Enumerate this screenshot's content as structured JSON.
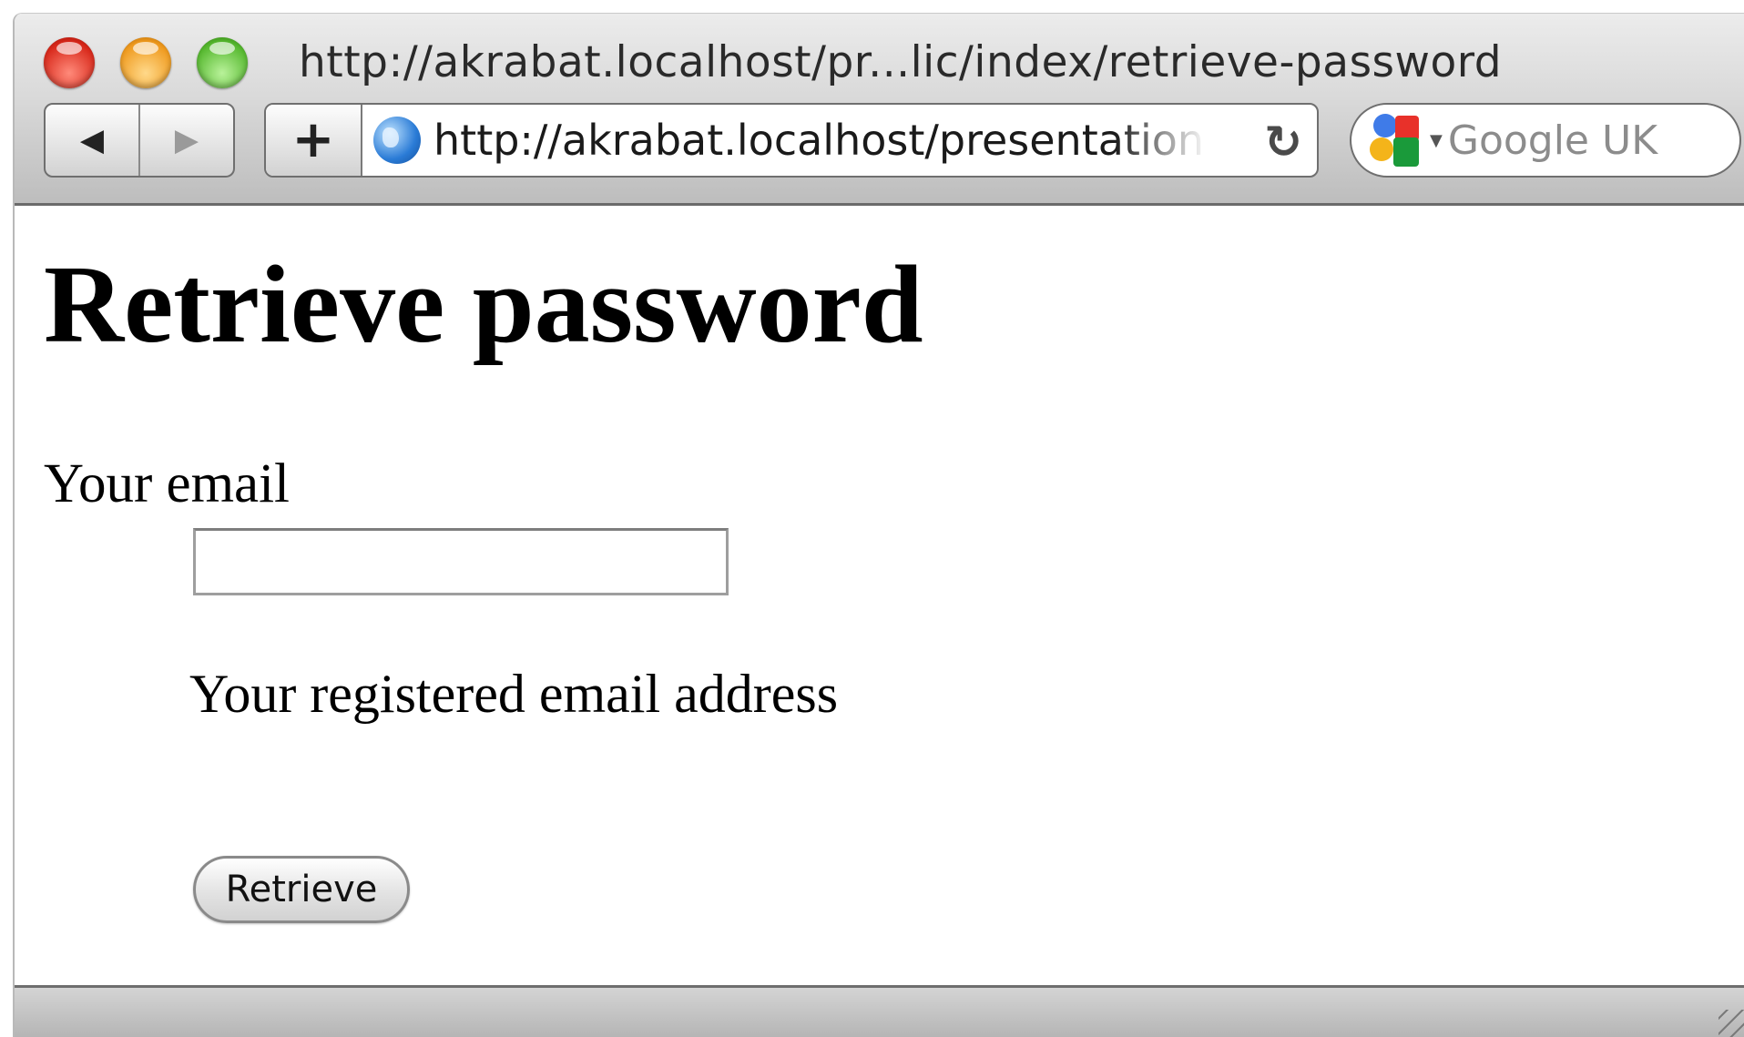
{
  "window": {
    "title": "http://akrabat.localhost/pr...lic/index/retrieve-password"
  },
  "toolbar": {
    "back_icon": "◀",
    "forward_icon": "▶",
    "add_bookmark_icon": "+",
    "url": "http://akrabat.localhost/presentation",
    "reload_icon": "↻",
    "search_placeholder": "Google UK"
  },
  "page": {
    "heading": "Retrieve password",
    "email_label": "Your email",
    "email_value": "",
    "email_hint": "Your registered email address",
    "submit_label": "Retrieve"
  },
  "colors": {
    "close": "#d8281a",
    "minimize": "#ef9a1e",
    "maximize": "#55b82e"
  }
}
